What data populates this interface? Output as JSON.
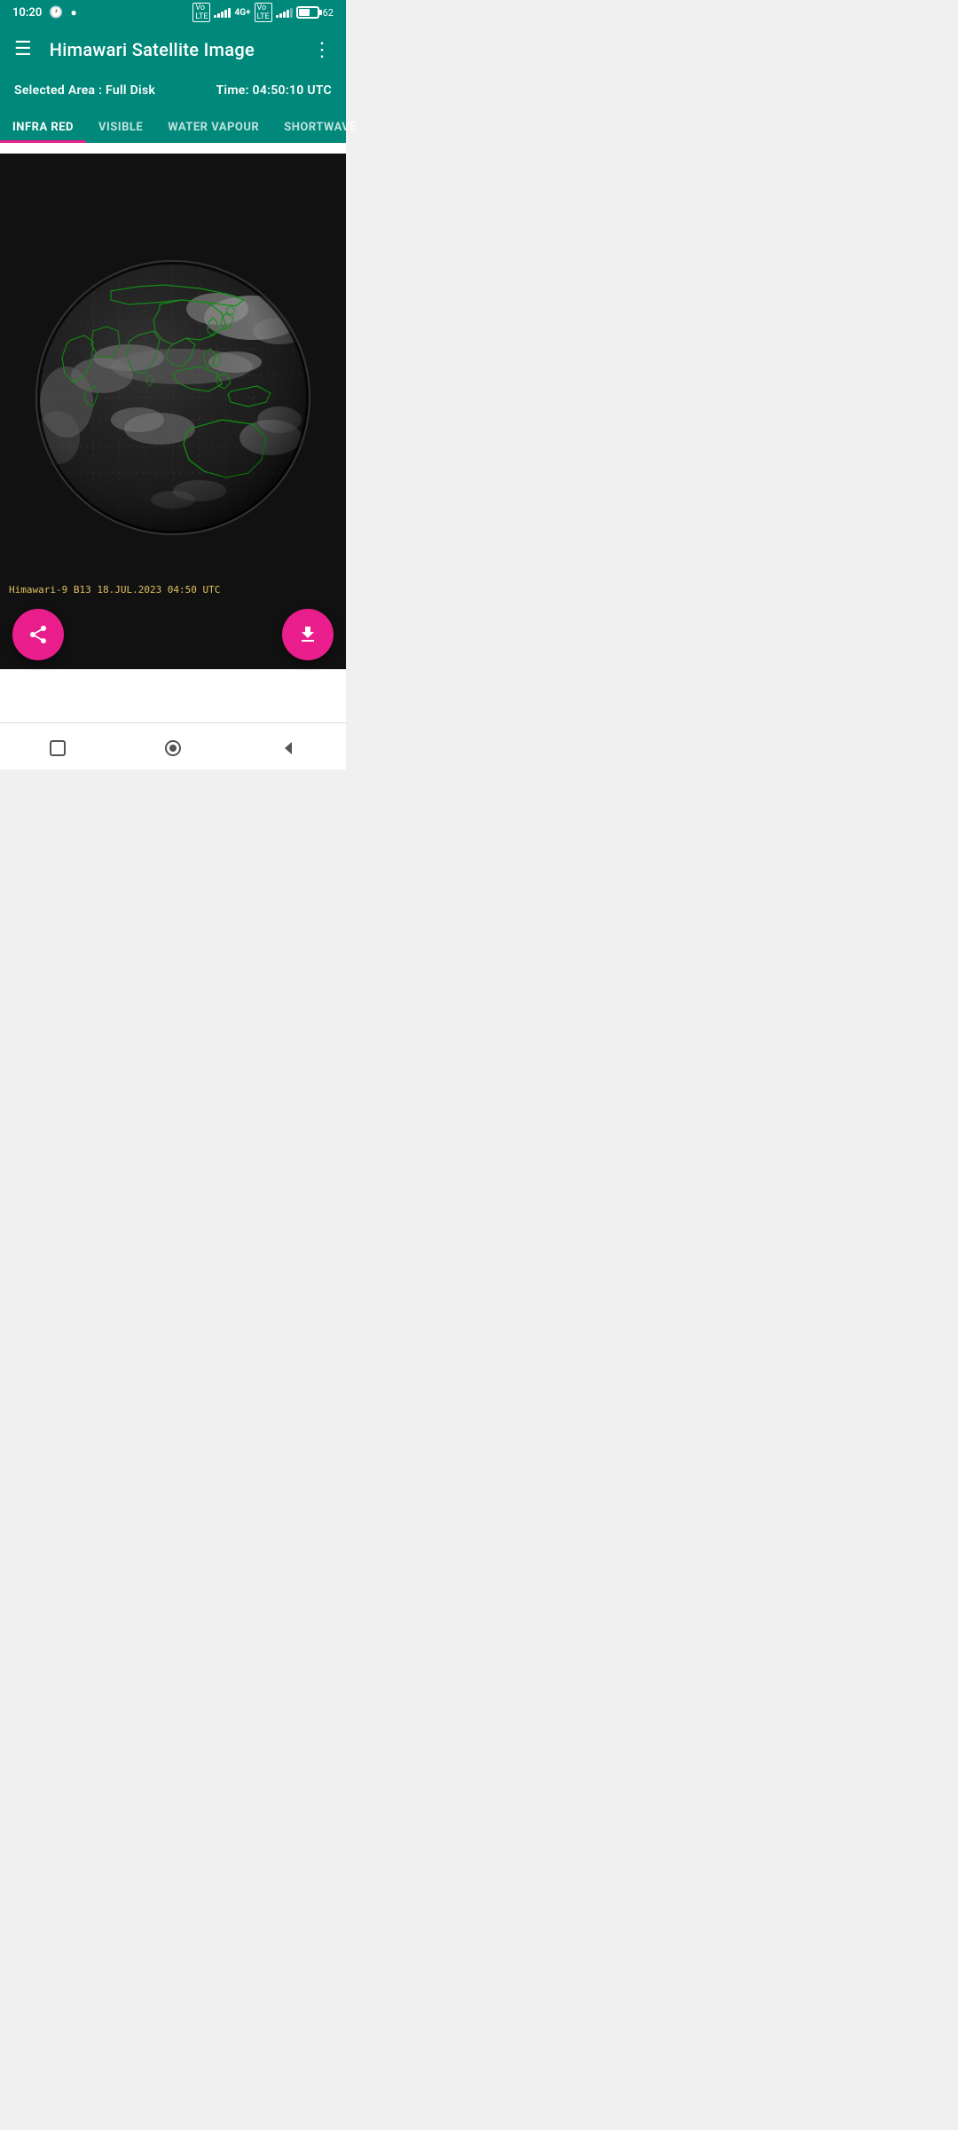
{
  "status": {
    "time": "10:20",
    "battery": "62",
    "network": "4G+"
  },
  "appBar": {
    "title": "Himawari Satellite Image",
    "menuIcon": "☰",
    "moreIcon": "⋮"
  },
  "infoBar": {
    "selectedArea": "Selected Area : Full Disk",
    "time": "Time: 04:50:10 UTC"
  },
  "tabs": [
    {
      "id": "infra-red",
      "label": "INFRA RED",
      "active": true
    },
    {
      "id": "visible",
      "label": "VISIBLE",
      "active": false
    },
    {
      "id": "water-vapour",
      "label": "WATER VAPOUR",
      "active": false
    },
    {
      "id": "shortwave",
      "label": "SHORTWAVE",
      "active": false
    }
  ],
  "image": {
    "caption": "Himawari-9 B13 18.JUL.2023 04:50 UTC"
  },
  "fabs": {
    "share": "share-icon",
    "download": "download-icon"
  },
  "nav": {
    "square": "■",
    "circle": "●",
    "back": "◀"
  }
}
